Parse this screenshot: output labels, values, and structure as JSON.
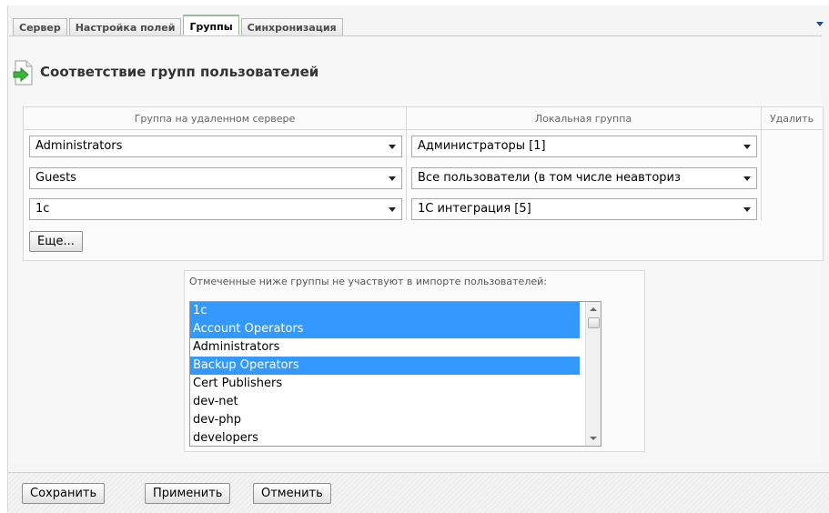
{
  "tabs": [
    {
      "label": "Сервер",
      "active": false
    },
    {
      "label": "Настройка полей",
      "active": false
    },
    {
      "label": "Группы",
      "active": true
    },
    {
      "label": "Синхронизация",
      "active": false
    }
  ],
  "page_title": "Соответствие групп пользователей",
  "mapping_table": {
    "headers": {
      "remote": "Группа на удаленном сервере",
      "local": "Локальная группа",
      "delete": "Удалить"
    },
    "rows": [
      {
        "remote": "Administrators",
        "local": "Администраторы [1]"
      },
      {
        "remote": "Guests",
        "local": "Все пользователи (в том числе неавториз"
      },
      {
        "remote": "1c",
        "local": "1С интеграция [5]"
      }
    ],
    "more_label": "Еще..."
  },
  "excluded": {
    "label": "Отмеченные ниже группы не участвуют в импорте пользователей:",
    "items": [
      {
        "label": "1c",
        "selected": true
      },
      {
        "label": "Account Operators",
        "selected": true
      },
      {
        "label": "Administrators",
        "selected": false
      },
      {
        "label": "Backup Operators",
        "selected": true
      },
      {
        "label": "Cert Publishers",
        "selected": false
      },
      {
        "label": "dev-net",
        "selected": false
      },
      {
        "label": "dev-php",
        "selected": false
      },
      {
        "label": "developers",
        "selected": false
      }
    ]
  },
  "footer": {
    "save": "Сохранить",
    "apply": "Применить",
    "cancel": "Отменить"
  },
  "colors": {
    "active_tab_accent": "#3a9e3a",
    "selection": "#3399ff"
  },
  "icons": {
    "title_icon": "import-arrow-icon",
    "tab_menu": "chevron-down-icon"
  }
}
